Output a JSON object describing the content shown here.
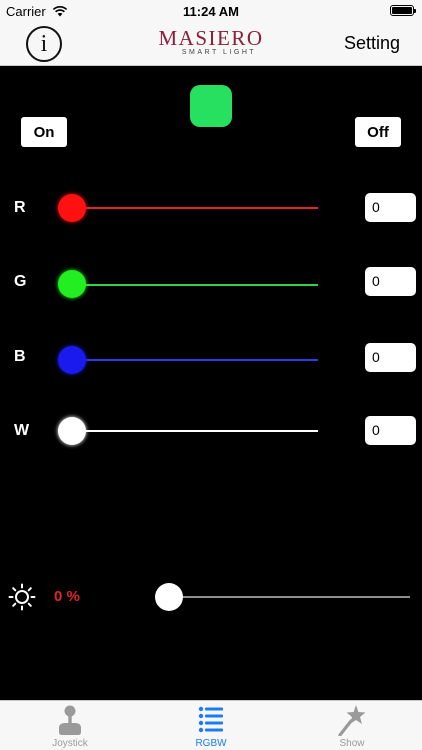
{
  "status_bar": {
    "carrier": "Carrier",
    "time": "11:24 AM"
  },
  "nav_bar": {
    "info_label": "i",
    "logo_text": "MASIERO",
    "logo_subtext": "SMART LIGHT",
    "setting_label": "Setting"
  },
  "main": {
    "preview_color": "#28e060",
    "on_label": "On",
    "off_label": "Off",
    "channels": [
      {
        "label": "R",
        "value": "0",
        "track_color": "#e0242a",
        "thumb_color": "#ff1111"
      },
      {
        "label": "G",
        "value": "0",
        "track_color": "#2bd64a",
        "thumb_color": "#22ee22"
      },
      {
        "label": "B",
        "value": "0",
        "track_color": "#2a3be8",
        "thumb_color": "#1a1aee"
      },
      {
        "label": "W",
        "value": "0",
        "track_color": "#ffffff",
        "thumb_color": "#ffffff"
      }
    ],
    "brightness": {
      "value_text": "0 %",
      "icon": "sun-icon"
    }
  },
  "tab_bar": {
    "tabs": [
      {
        "label": "Joystick",
        "icon": "joystick-icon",
        "active": false
      },
      {
        "label": "RGBW",
        "icon": "list-icon",
        "active": true
      },
      {
        "label": "Show",
        "icon": "magic-wand-icon",
        "active": false
      }
    ],
    "active_color": "#1a7cf5",
    "inactive_color": "#9a9a9a"
  }
}
